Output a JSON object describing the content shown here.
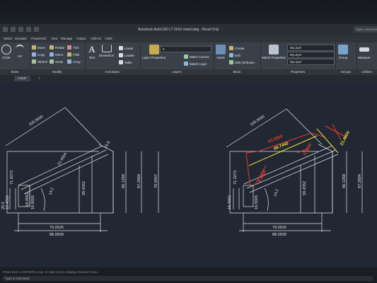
{
  "titlebar": {
    "title": "Autodesk AutoCAD LT 2016   metal.dwg - Read Only",
    "search_placeholder": "Type a keyword"
  },
  "tabs": [
    "Select",
    "Annotate",
    "Parametric",
    "View",
    "Manage",
    "Output",
    "Add-ins",
    "A360"
  ],
  "ribbon": {
    "draw": {
      "title": "Draw",
      "circle": "Circle",
      "arc": "Arc"
    },
    "modify": {
      "title": "Modify",
      "move": "Move",
      "copy": "Copy",
      "stretch": "Stretch",
      "rotate": "Rotate",
      "mirror": "Mirror",
      "scale": "Scale",
      "trim": "Trim",
      "fillet": "Fillet",
      "array": "Array"
    },
    "annotation": {
      "title": "Annotation",
      "text": "Text",
      "dimension": "Dimension",
      "linear": "Linear",
      "leader": "Leader",
      "table": "Table"
    },
    "layers": {
      "title": "Layers",
      "layer_properties": "Layer Properties",
      "layer_value": "0",
      "make_current": "Make Current",
      "match_layer": "Match Layer"
    },
    "block": {
      "title": "Block",
      "insert": "Insert",
      "create": "Create",
      "edit": "Edit",
      "edit_attributes": "Edit Attributes"
    },
    "properties": {
      "title": "Properties",
      "match_properties": "Match Properties",
      "color": "ByLayer",
      "linetype": "ByLayer",
      "lineweight": "ByLayer"
    },
    "groups": {
      "title": "Groups",
      "group": "Group"
    },
    "utilities": {
      "title": "Utilities",
      "measure": "Measure"
    }
  },
  "file_tabs": {
    "active": "metal*"
  },
  "drawing": {
    "left": {
      "top_dim": "100.0000",
      "d1": "71.3273",
      "d2": "21.4004",
      "d3": "16.4552",
      "d4": "58.4552",
      "d5": "14.2",
      "d6": "18.4652",
      "d7": "66.1268",
      "d8": "67.2804",
      "d9": "70.5647",
      "d10": "20.5",
      "b1": "79.0526",
      "b2": "88.9509",
      "b3": "16.9026",
      "b4": "15.8"
    },
    "right": {
      "top_dim": "100.0000",
      "red1": "63.0000",
      "yel1": "88.7440",
      "red2": "3.0000",
      "red3": "8.5000",
      "yel2": "21.4004",
      "d1": "71.3273",
      "d3": "16.4552",
      "d4": "58.4552",
      "d5": "14.2",
      "d7": "66.1268",
      "d8": "67.2804",
      "b1": "79.0526",
      "b2": "88.9509",
      "b3": "16.9026"
    }
  },
  "command": {
    "history": "Press ESC or ENTER to exit, or right-click to display shortcut menu.",
    "placeholder": "Type a command"
  }
}
